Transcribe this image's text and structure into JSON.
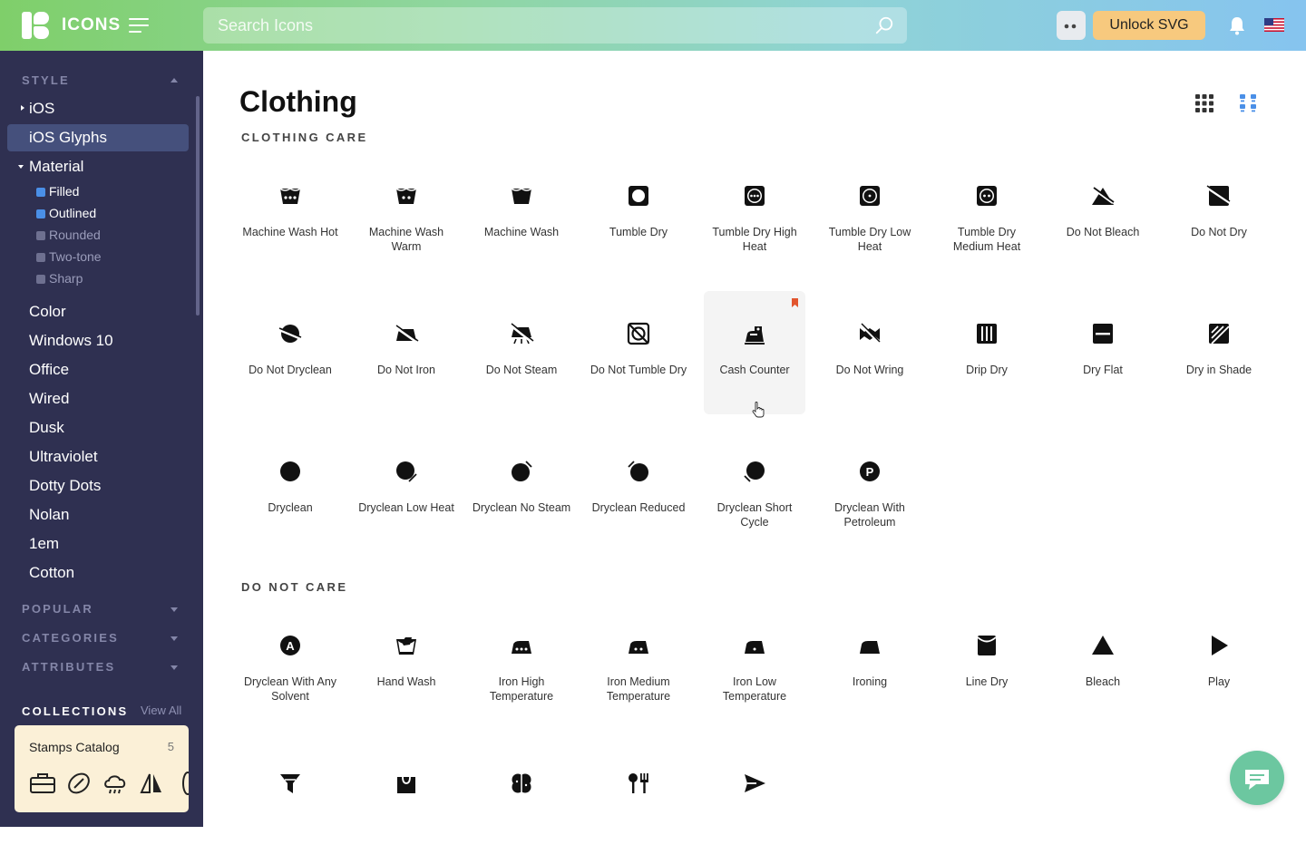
{
  "app": {
    "logo_text": "ICONS"
  },
  "topbar": {
    "search_placeholder": "Search Icons",
    "unlock_label": "Unlock SVG"
  },
  "sidebar": {
    "style_label": "STYLE",
    "styles": [
      {
        "label": "iOS"
      },
      {
        "label": "iOS Glyphs"
      },
      {
        "label": "Material"
      }
    ],
    "material_subs": [
      {
        "label": "Filled",
        "active": true
      },
      {
        "label": "Outlined",
        "active": true
      },
      {
        "label": "Rounded",
        "active": false
      },
      {
        "label": "Two-tone",
        "active": false
      },
      {
        "label": "Sharp",
        "active": false
      }
    ],
    "more_styles": [
      "Color",
      "Windows 10",
      "Office",
      "Wired",
      "Dusk",
      "Ultraviolet",
      "Dotty Dots",
      "Nolan",
      "1em",
      "Cotton"
    ],
    "popular_label": "POPULAR",
    "categories_label": "CATEGORIES",
    "attributes_label": "ATTRIBUTES",
    "collections_label": "COLLECTIONS",
    "view_all_label": "View All",
    "collection": {
      "name": "Stamps Catalog",
      "count": "5"
    }
  },
  "main": {
    "title": "Clothing",
    "section_care": "CLOTHING CARE",
    "section_donot": "DO NOT CARE",
    "care_icons": [
      {
        "label": "Machine Wash Hot",
        "icon": "machine-wash-hot-icon"
      },
      {
        "label": "Machine Wash Warm",
        "icon": "machine-wash-warm-icon"
      },
      {
        "label": "Machine Wash",
        "icon": "machine-wash-icon"
      },
      {
        "label": "Tumble Dry",
        "icon": "tumble-dry-icon"
      },
      {
        "label": "Tumble Dry High Heat",
        "icon": "tumble-dry-high-heat-icon"
      },
      {
        "label": "Tumble Dry Low Heat",
        "icon": "tumble-dry-low-heat-icon"
      },
      {
        "label": "Tumble Dry Medium Heat",
        "icon": "tumble-dry-medium-heat-icon"
      },
      {
        "label": "Do Not Bleach",
        "icon": "do-not-bleach-icon"
      },
      {
        "label": "Do Not Dry",
        "icon": "do-not-dry-icon"
      },
      {
        "label": "Do Not Dryclean",
        "icon": "do-not-dryclean-icon"
      },
      {
        "label": "Do Not Iron",
        "icon": "do-not-iron-icon"
      },
      {
        "label": "Do Not Steam",
        "icon": "do-not-steam-icon"
      },
      {
        "label": "Do Not Tumble Dry",
        "icon": "do-not-tumble-dry-icon"
      },
      {
        "label": "Cash Counter",
        "icon": "cash-counter-icon"
      },
      {
        "label": "Do Not Wring",
        "icon": "do-not-wring-icon"
      },
      {
        "label": "Drip Dry",
        "icon": "drip-dry-icon"
      },
      {
        "label": "Dry Flat",
        "icon": "dry-flat-icon"
      },
      {
        "label": "Dry in Shade",
        "icon": "dry-in-shade-icon"
      },
      {
        "label": "Dryclean",
        "icon": "dryclean-icon"
      },
      {
        "label": "Dryclean Low Heat",
        "icon": "dryclean-low-heat-icon"
      },
      {
        "label": "Dryclean No Steam",
        "icon": "dryclean-no-steam-icon"
      },
      {
        "label": "Dryclean Reduced",
        "icon": "dryclean-reduced-icon"
      },
      {
        "label": "Dryclean Short Cycle",
        "icon": "dryclean-short-cycle-icon"
      },
      {
        "label": "Dryclean With Petroleum",
        "icon": "dryclean-with-petroleum-icon"
      }
    ],
    "donot_icons": [
      {
        "label": "Dryclean With Any Solvent",
        "icon": "dryclean-any-solvent-icon"
      },
      {
        "label": "Hand Wash",
        "icon": "hand-wash-icon"
      },
      {
        "label": "Iron High Temperature",
        "icon": "iron-high-temperature-icon"
      },
      {
        "label": "Iron Medium Temperature",
        "icon": "iron-medium-temperature-icon"
      },
      {
        "label": "Iron Low Temperature",
        "icon": "iron-low-temperature-icon"
      },
      {
        "label": "Ironing",
        "icon": "ironing-icon"
      },
      {
        "label": "Line Dry",
        "icon": "line-dry-icon"
      },
      {
        "label": "Bleach",
        "icon": "bleach-icon"
      },
      {
        "label": "Play",
        "icon": "play-icon"
      },
      {
        "label": "",
        "icon": "funnel-icon"
      },
      {
        "label": "",
        "icon": "shopping-bag-icon"
      },
      {
        "label": "",
        "icon": "brain-icon"
      },
      {
        "label": "",
        "icon": "restaurant-icon"
      },
      {
        "label": "",
        "icon": "send-icon"
      }
    ]
  },
  "colors": {
    "sidebar_bg": "#2f3051",
    "selected_bg": "#45507c",
    "accent": "#4a8fe7",
    "unlock": "#f7c97e",
    "bookmark": "#e2552e",
    "chat": "#6cc7a0"
  }
}
